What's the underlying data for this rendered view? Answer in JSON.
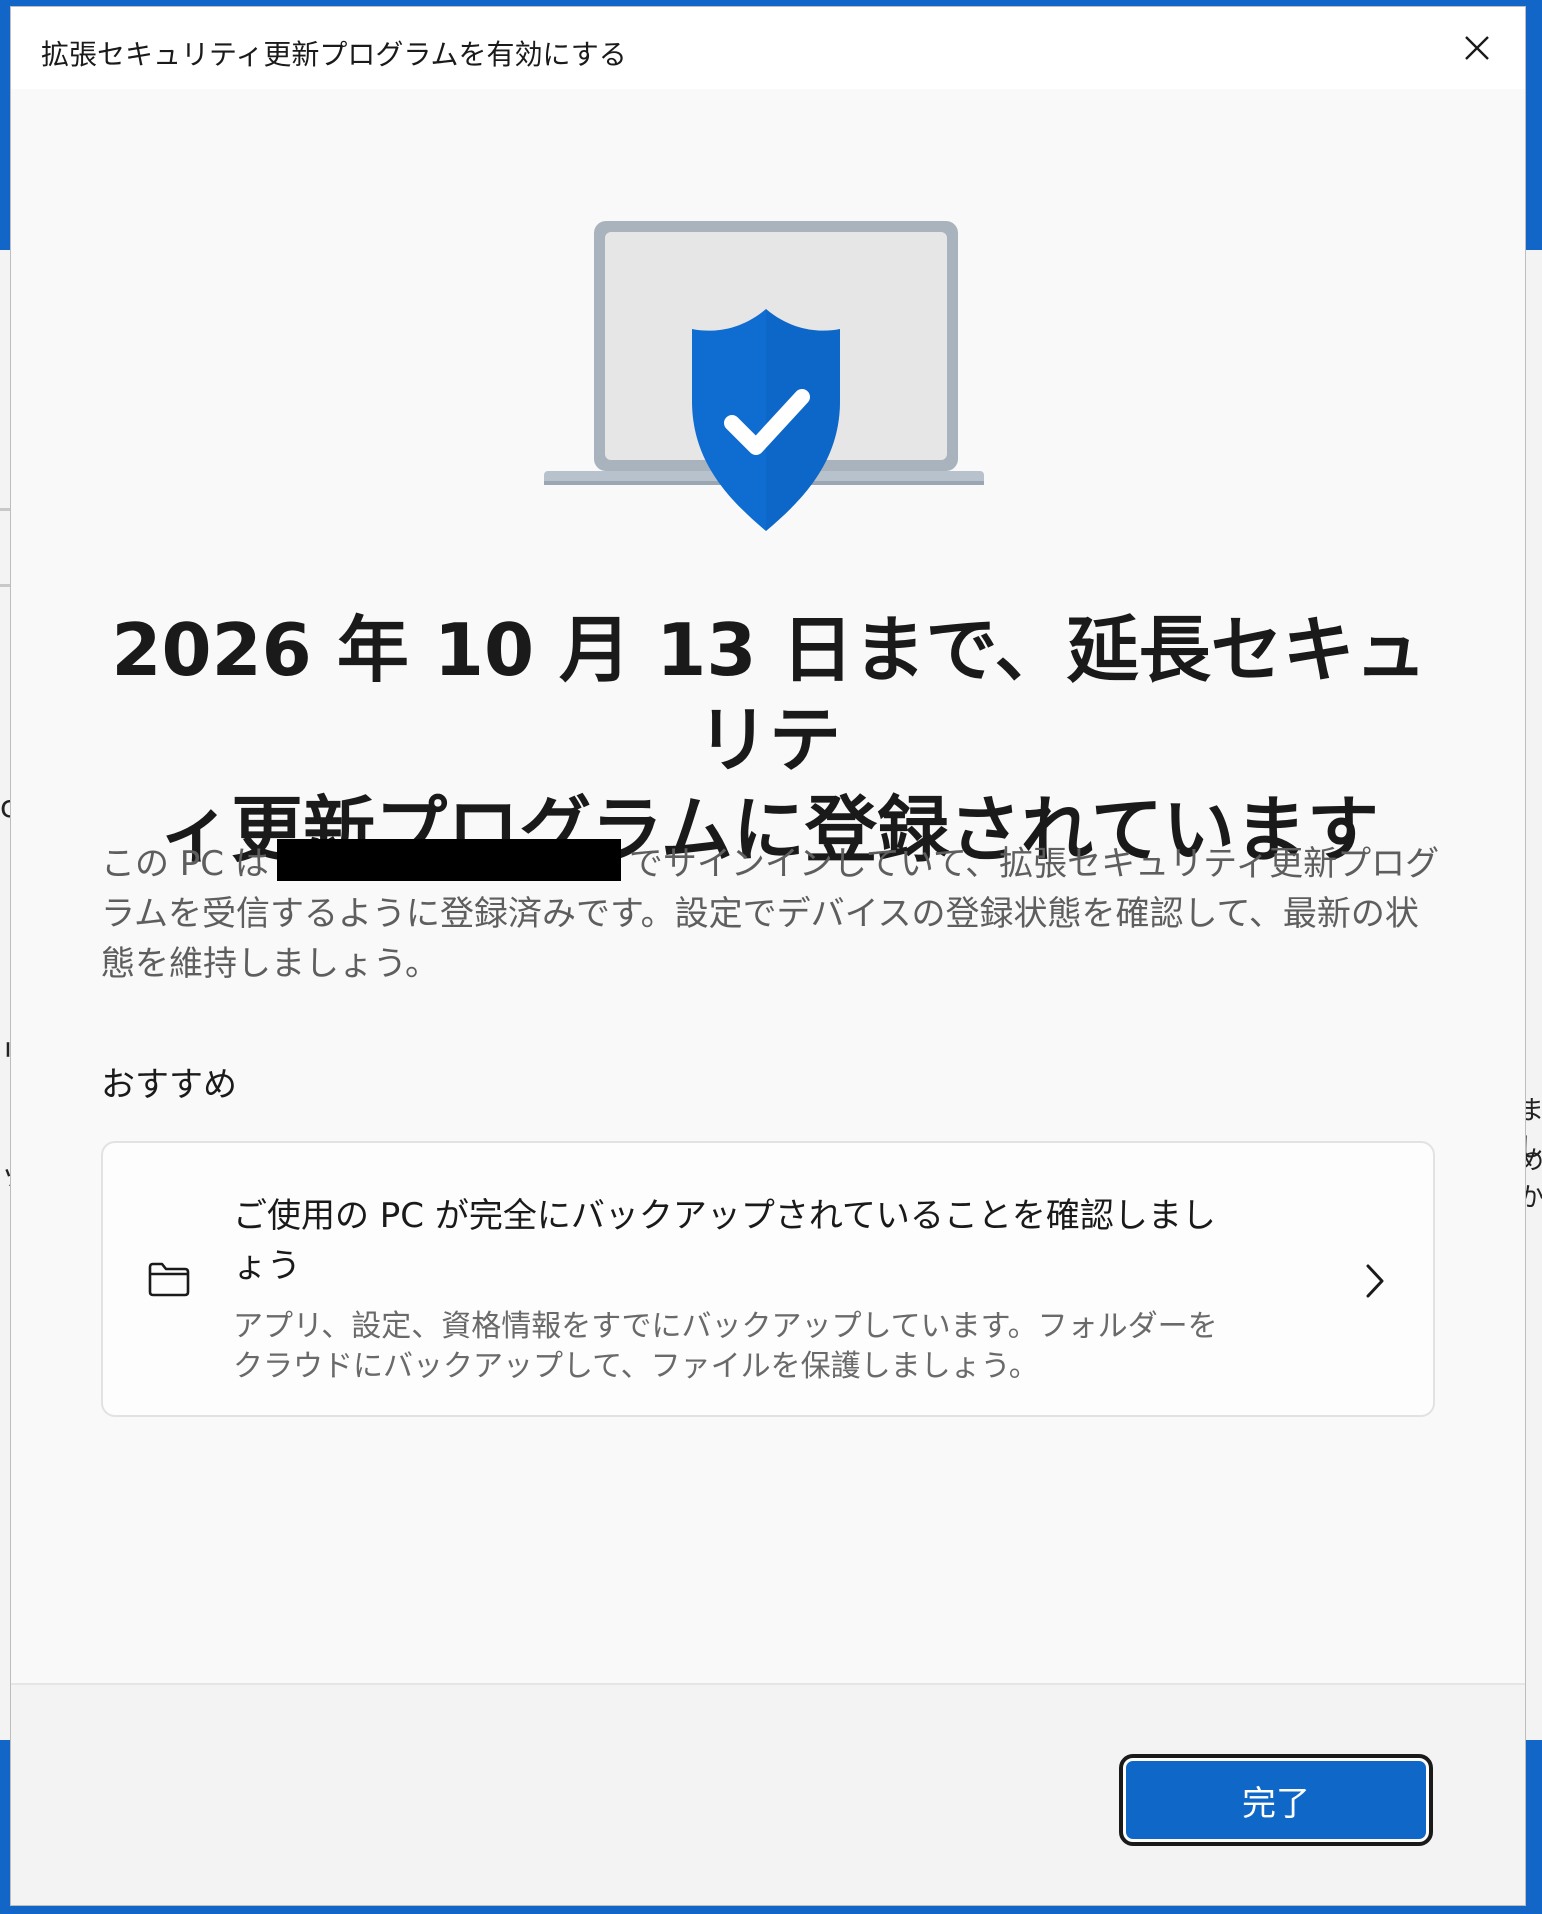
{
  "dialog": {
    "title": "拡張セキュリティ更新プログラムを有効にする"
  },
  "main": {
    "headline_line1": "2026 年 10 月 13 日まで、延長セキュリテ",
    "headline_line2": "ィ更新プログラムに登録されています",
    "desc_prefix": "この PC は",
    "desc_body": "でサインインしていて、拡張セキュリティ更新プログラムを受信するように登録済みです。設定でデバイスの登録状態を確認して、最新の状態を維持しましょう。",
    "section_label": "おすすめ"
  },
  "recommendation": {
    "title": "ご使用の PC が完全にバックアップされていることを確認しましょう",
    "subtitle": "アプリ、設定、資格情報をすでにバックアップしています。フォルダーをクラウドにバックアップして、ファイルを保護しましょう。"
  },
  "footer": {
    "done_label": "完了"
  },
  "background": {
    "left_chars": [
      "c",
      "リ",
      "ッ"
    ],
    "right_chars": [
      "まし",
      "めか"
    ]
  },
  "colors": {
    "accent": "#0f67c7",
    "shield": "#0f6cd1",
    "desktop": "#1266c8"
  },
  "icons": {
    "close": "close-icon",
    "hero": "laptop-shield-check-icon",
    "folder": "folder-icon",
    "chevron": "chevron-right-icon"
  }
}
